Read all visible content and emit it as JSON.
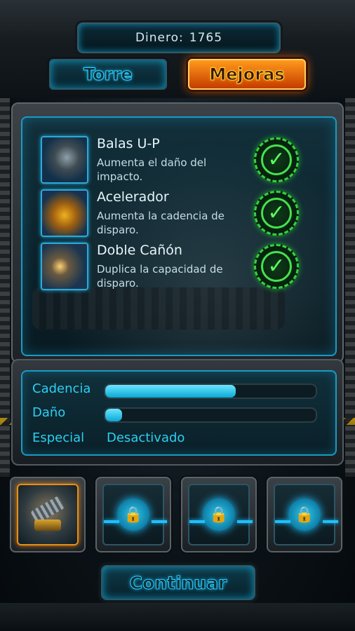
{
  "header": {
    "money_label": "Dinero:",
    "money_value": "1765"
  },
  "tabs": [
    {
      "label": "Torre",
      "active": false
    },
    {
      "label": "Mejoras",
      "active": true
    }
  ],
  "upgrades": [
    {
      "name": "Balas U-P",
      "description": "Aumenta el daño del impacto.",
      "icon": "bullet-icon",
      "purchased": true
    },
    {
      "name": "Acelerador",
      "description": "Aumenta la cadencia de disparo.",
      "icon": "accelerator-icon",
      "purchased": true
    },
    {
      "name": "Doble Cañón",
      "description": "Duplica la capacidad de disparo.",
      "icon": "double-cannon-icon",
      "purchased": true
    }
  ],
  "stats": {
    "cadencia": {
      "label": "Cadencia",
      "level": 0.62
    },
    "dano": {
      "label": "Daño",
      "level": 0.08
    },
    "especial": {
      "label": "Especial",
      "value": "Desactivado"
    }
  },
  "slots": [
    {
      "state": "active",
      "icon": "turret-icon"
    },
    {
      "state": "locked",
      "icon": "lock-icon"
    },
    {
      "state": "locked",
      "icon": "lock-icon"
    },
    {
      "state": "locked",
      "icon": "lock-icon"
    }
  ],
  "actions": {
    "continue_label": "Continuar"
  },
  "colors": {
    "accent": "#1ab6e8",
    "active_tab": "#ff8a00",
    "check": "#47e04f"
  }
}
